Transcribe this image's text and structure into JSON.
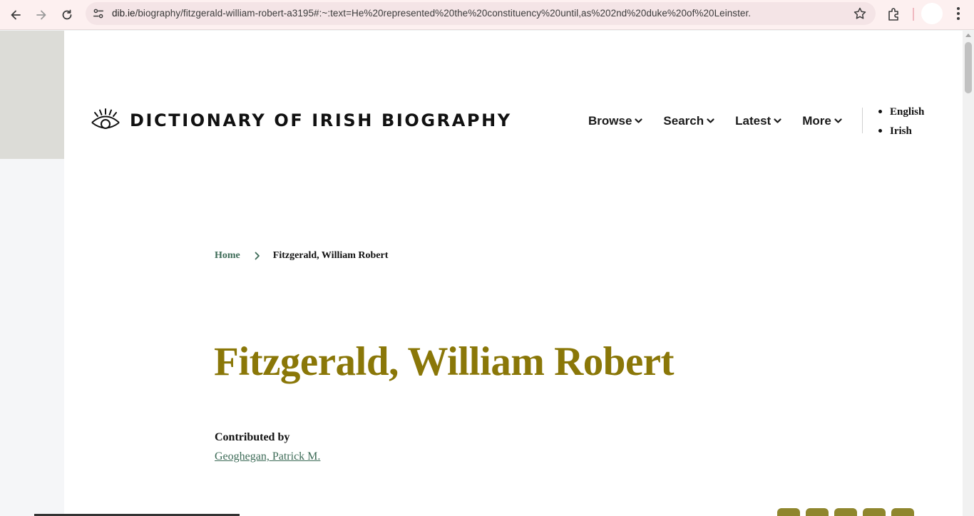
{
  "browser": {
    "url_host": "dib.ie",
    "url_rest": "/biography/fitzgerald-william-robert-a3195#:~:text=He%20represented%20the%20constituency%20until,as%202nd%20duke%20of%20Leinster."
  },
  "site": {
    "logo_text": "DICTIONARY OF IRISH BIOGRAPHY",
    "nav": [
      {
        "label": "Browse"
      },
      {
        "label": "Search"
      },
      {
        "label": "Latest"
      },
      {
        "label": "More"
      }
    ],
    "languages": [
      "English",
      "Irish"
    ]
  },
  "breadcrumb": {
    "home": "Home",
    "current": "Fitzgerald, William Robert"
  },
  "article": {
    "title": "Fitzgerald, William Robert",
    "contributed_label": "Contributed by",
    "contributor": "Geoghegan, Patrick M."
  },
  "colors": {
    "title": "#8a7708",
    "link": "#3d6b57",
    "share": "#8f862e"
  }
}
